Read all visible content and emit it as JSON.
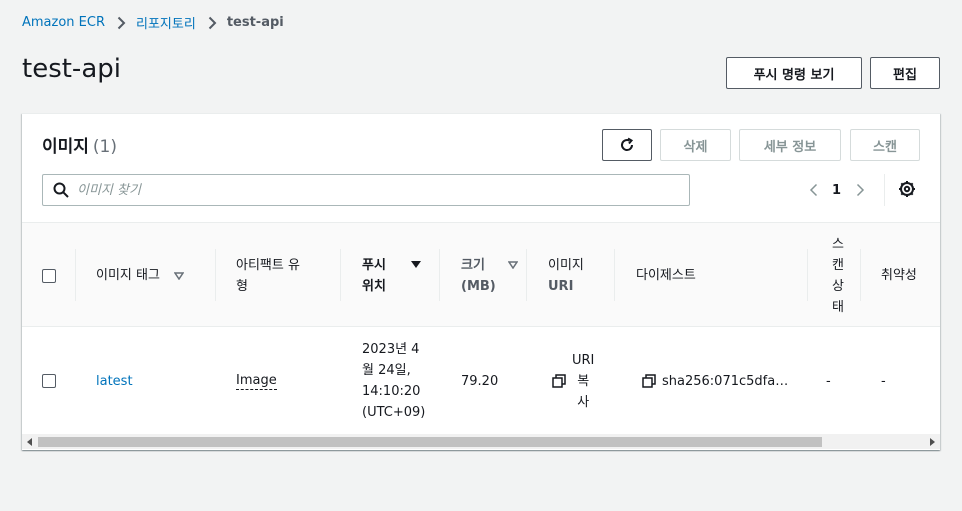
{
  "breadcrumb": {
    "items": [
      "Amazon ECR",
      "리포지토리"
    ],
    "current": "test-api"
  },
  "page": {
    "title": "test-api",
    "actions": {
      "push_commands": "푸시 명령 보기",
      "edit": "편집"
    }
  },
  "images": {
    "title": "이미지",
    "count": "(1)",
    "toolbar": {
      "delete": "삭제",
      "details": "세부 정보",
      "scan": "스캔"
    },
    "search": {
      "placeholder": "이미지 찾기",
      "value": ""
    },
    "pagination": {
      "current_page": "1"
    },
    "columns": {
      "tag": "이미지 태그",
      "artifact_type_l1": "아티팩트 유",
      "artifact_type_l2": "형",
      "pushed_l1": "푸시",
      "pushed_l2": "위치",
      "size_l1": "크기",
      "size_l2": "(MB)",
      "uri_l1": "이미지",
      "uri_l2": "URI",
      "digest": "다이제스트",
      "scan_status": [
        "스",
        "캔",
        "상",
        "태"
      ],
      "vulnerabilities": "취약성"
    },
    "rows": [
      {
        "tag": "latest",
        "artifact_type": "Image",
        "pushed_at": [
          "2023년 4",
          "월 24일,",
          "14:10:20",
          "(UTC+09)"
        ],
        "size": "79.20",
        "uri_copy": [
          "URI",
          "복",
          "사"
        ],
        "digest": "sha256:071c5dfa…",
        "scan_status": "-",
        "vulnerabilities": "-"
      }
    ]
  },
  "colors": {
    "link": "#0073bb",
    "background": "#f2f3f3",
    "border": "#545b64",
    "disabled": "#879596"
  }
}
